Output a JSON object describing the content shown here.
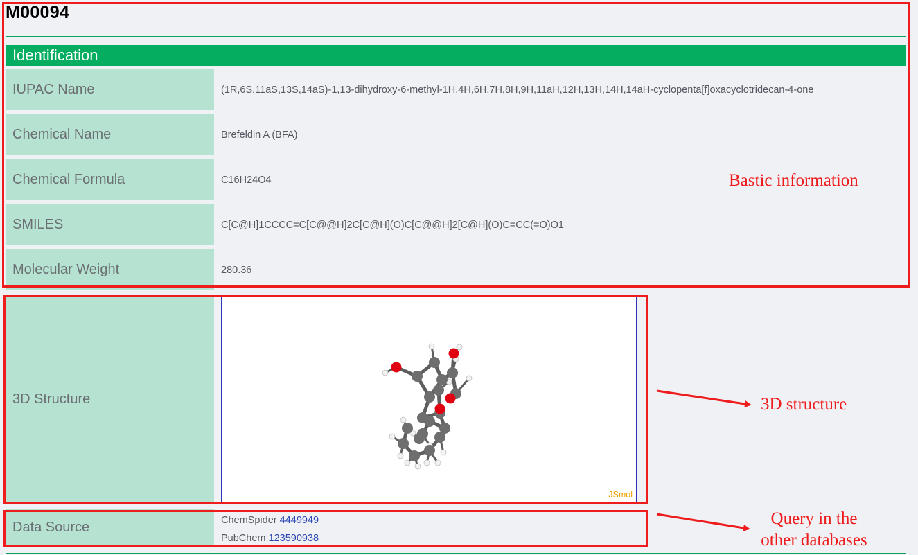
{
  "compound_id": "M00094",
  "section_title": "Identification",
  "rows": [
    {
      "label": "IUPAC Name",
      "value": "(1R,6S,11aS,13S,14aS)‑1,13‑dihydroxy‑6‑methyl‑1H,4H,6H,7H,8H,9H,11aH,12H,13H,14H,14aH‑cyclopenta[f]oxacyclotridecan‑4‑one"
    },
    {
      "label": "Chemical Name",
      "value": "Brefeldin A (BFA)"
    },
    {
      "label": "Chemical Formula",
      "value": "C16H24O4"
    },
    {
      "label": "SMILES",
      "value": "C[C@H]1CCCC=C[C@@H]2C[C@H](O)C[C@@H]2[C@H](O)C=CC(=O)O1"
    },
    {
      "label": "Molecular Weight",
      "value": "280.36"
    }
  ],
  "structure": {
    "label": "3D Structure",
    "viewer_name": "JSmol",
    "viewer_brand_color": "#f0a000"
  },
  "data_source": {
    "label": "Data Source",
    "entries": [
      {
        "db": "ChemSpider",
        "id": "4449949"
      },
      {
        "db": "PubChem",
        "id": "123590938"
      }
    ]
  },
  "annotations": {
    "basic_info": "Bastic information",
    "structure": "3D structure",
    "query_line1": "Query in the",
    "query_line2": "other databases",
    "color": "#ee1c1c"
  },
  "colors": {
    "accent_green": "#04ad5f",
    "label_bg": "#b6e3d1",
    "page_bg": "#f0f1f5",
    "link": "#2a46b4",
    "atom_carbon": "#6e6e6e",
    "atom_oxygen": "#e00012",
    "atom_hydrogen": "#f2f2f2"
  }
}
